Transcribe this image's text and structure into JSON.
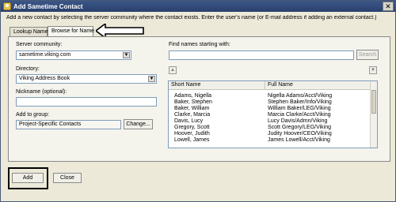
{
  "window": {
    "title": "Add Sametime Contact",
    "close_glyph": "✕",
    "app_icon": "sametime-icon"
  },
  "instructions": "Add a new contact by selecting the server community where the contact exists.  Enter the user's name (or E-mail address if adding an external contact.)",
  "tabs": [
    {
      "label": "Lookup Name",
      "active": false
    },
    {
      "label": "Browse for Name",
      "active": true
    }
  ],
  "left": {
    "server_label": "Server community:",
    "server_value": "sametime.viking.com",
    "directory_label": "Directory:",
    "directory_value": "Viking Address Book",
    "nickname_label": "Nickname (optional):",
    "nickname_value": "",
    "group_label": "Add to group:",
    "group_value": "Project-Specific Contacts",
    "change_label": "Change..."
  },
  "right": {
    "find_label": "Find names starting with:",
    "find_value": "",
    "search_label": "Search",
    "prev_glyph": "▲",
    "next_glyph": "▼",
    "columns": [
      "Short Name",
      "Full Name"
    ],
    "rows": [
      [
        "Adams, Nigella",
        "Nigella Adams/Acct/Viking"
      ],
      [
        "Baker, Stephen",
        "Stephen Baker/Info/Viking"
      ],
      [
        "Baker, William",
        "William Baker/LEG/Viking"
      ],
      [
        "Clarke, Marcia",
        "Marcia Clarke/Acct/Viking"
      ],
      [
        "Davis, Lucy",
        "Lucy Davis/Admn/Viking"
      ],
      [
        "Gregory, Scott",
        "Scott Gregory/LEG/Viking"
      ],
      [
        "Hoover, Judith",
        "Judity Hoover/CEO/Viking"
      ],
      [
        "Lowell, James",
        "James Lowell/Acct/Viking"
      ]
    ]
  },
  "footer": {
    "add_label": "Add",
    "close_label": "Close"
  },
  "colors": {
    "titlebar": "#2f4a7a",
    "dialog_bg": "#ece9d8"
  }
}
